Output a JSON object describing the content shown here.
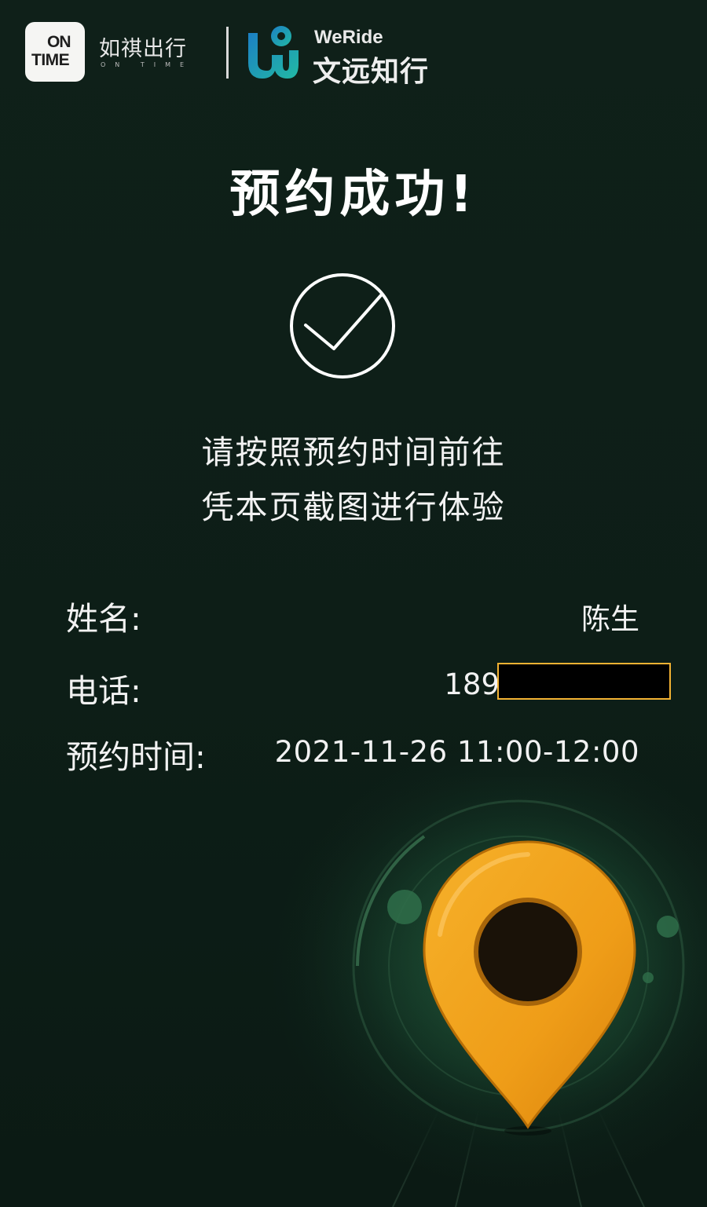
{
  "header": {
    "ontime_logo_top": "ON",
    "ontime_logo_bottom": "TIME",
    "ruqi_name": "如祺出行",
    "ruqi_subtitle": "ON TIME",
    "weride_name_en": "WeRide",
    "weride_name_cn": "文远知行"
  },
  "title": "预约成功!",
  "icons": {
    "success": "check-circle-icon",
    "pin": "map-pin-icon"
  },
  "message": {
    "line1": "请按照预约时间前往",
    "line2": "凭本页截图进行体验"
  },
  "info": {
    "name_label": "姓名:",
    "name_value": "陈生",
    "phone_label": "电话:",
    "phone_value": "189",
    "time_label": "预约时间:",
    "time_value": "2021-11-26 11:00-12:00"
  },
  "colors": {
    "background": "#0d1d17",
    "text": "#ffffff",
    "pin_orange": "#f0a51e",
    "ontime_yellow": "#f0a800",
    "weride_teal": "#1aa6a6",
    "redaction_border": "#f2b233"
  }
}
